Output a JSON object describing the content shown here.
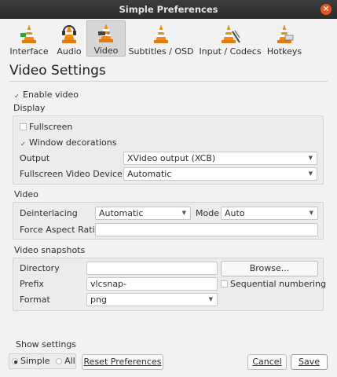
{
  "window": {
    "title": "Simple Preferences"
  },
  "categories": [
    {
      "label": "Interface",
      "icon": "interface-cone-icon"
    },
    {
      "label": "Audio",
      "icon": "audio-cone-headphones-icon"
    },
    {
      "label": "Video",
      "icon": "video-cone-icon",
      "active": true
    },
    {
      "label": "Subtitles / OSD",
      "icon": "subtitles-cone-icon"
    },
    {
      "label": "Input / Codecs",
      "icon": "input-cone-icon"
    },
    {
      "label": "Hotkeys",
      "icon": "hotkeys-cone-icon"
    }
  ],
  "page": {
    "title": "Video Settings"
  },
  "video_enable": {
    "label": "Enable video",
    "checked": true
  },
  "display": {
    "title": "Display",
    "fullscreen": {
      "label": "Fullscreen",
      "checked": false
    },
    "window_decorations": {
      "label": "Window decorations",
      "checked": true
    },
    "output_label": "Output",
    "output_value": "XVideo output (XCB)",
    "fs_device_label": "Fullscreen Video Device",
    "fs_device_value": "Automatic"
  },
  "video": {
    "title": "Video",
    "deinterlacing_label": "Deinterlacing",
    "deinterlacing_value": "Automatic",
    "mode_label": "Mode",
    "mode_value": "Auto",
    "aspect_label": "Force Aspect Ratio",
    "aspect_value": ""
  },
  "snapshots": {
    "title": "Video snapshots",
    "directory_label": "Directory",
    "directory_value": "",
    "browse_label": "Browse...",
    "prefix_label": "Prefix",
    "prefix_value": "vlcsnap-",
    "sequential_label": "Sequential numbering",
    "sequential_checked": false,
    "format_label": "Format",
    "format_value": "png"
  },
  "footer": {
    "show_settings_label": "Show settings",
    "simple_label": "Simple",
    "all_label": "All",
    "reset_label": "Reset Preferences",
    "cancel_label": "Cancel",
    "save_label": "Save"
  },
  "colors": {
    "titlebar": "#2f2f2f",
    "close": "#e95420",
    "vlc_orange": "#f28a12"
  }
}
